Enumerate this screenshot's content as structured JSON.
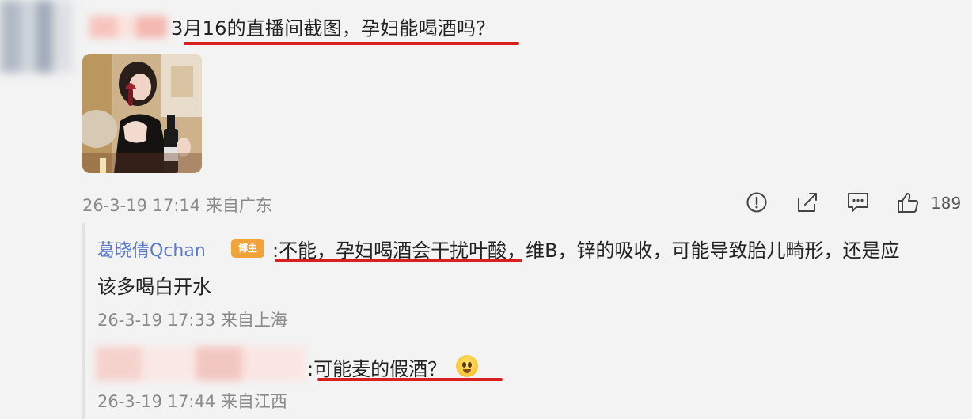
{
  "comment": {
    "text": "3月16的直播间截图，孕妇能喝酒吗？",
    "timestamp": "26-3-19 17:14 来自广东",
    "likes": "189",
    "underline_color": "#d8201f"
  },
  "actions": {
    "report_icon": "alert-circle-icon",
    "share_icon": "share-icon",
    "comment_icon": "comment-icon",
    "like_icon": "thumbs-up-icon"
  },
  "replies": [
    {
      "user": "葛晓倩Qchan",
      "badge": "博主",
      "text_line1": ":不能，孕妇喝酒会干扰叶酸，维B，锌的吸收，可能导致胎儿畸形，还是应",
      "text_line2": "该多喝白开水",
      "timestamp": "26-3-19 17:33 来自上海"
    },
    {
      "text": ":可能麦的假酒？",
      "timestamp": "26-3-19 17:44 来自江西"
    }
  ],
  "colors": {
    "background": "#f3f3f3",
    "username": "#5b7ac7",
    "meta": "#8a8a8a",
    "badge": "#f2a23b"
  }
}
